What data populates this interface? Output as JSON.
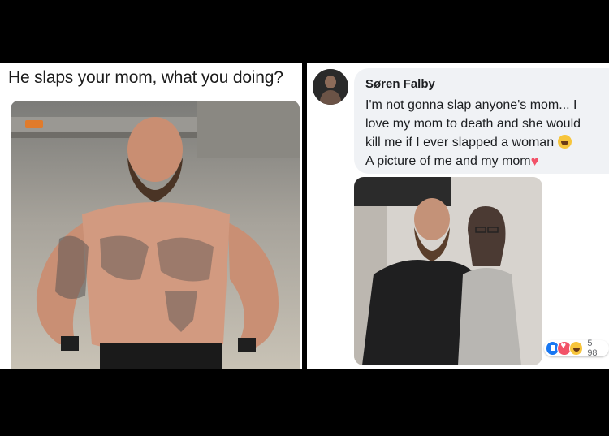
{
  "meme": {
    "caption": "He slaps your mom, what you doing?"
  },
  "comment": {
    "author": "Søren Falby",
    "lines": [
      "I'm not gonna slap anyone's mom... I",
      "love my mom to death and she would",
      "kill me if I ever slapped a woman",
      "A picture of me and my mom"
    ],
    "emoji": [
      "laughing-emoji",
      "heart-emoji"
    ],
    "reactions": {
      "icons": [
        "like-icon",
        "love-icon",
        "haha-icon"
      ],
      "count": "5 98"
    }
  },
  "colors": {
    "bubble": "#f0f2f5",
    "author": "#1c1e21",
    "like": "#1877f2",
    "love": "#f25268",
    "haha": "#f7c53b"
  }
}
